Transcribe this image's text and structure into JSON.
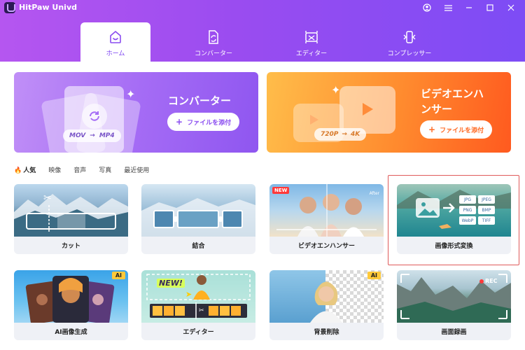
{
  "app": {
    "title": "HitPaw Univd"
  },
  "window_controls": [
    {
      "name": "account-icon",
      "glyph": "◯"
    },
    {
      "name": "menu-icon",
      "glyph": "≡"
    },
    {
      "name": "minimize-icon",
      "glyph": "—"
    },
    {
      "name": "maximize-icon",
      "glyph": "☐"
    },
    {
      "name": "close-icon",
      "glyph": "✕"
    }
  ],
  "tabs": [
    {
      "label": "ホーム",
      "icon": "home-icon",
      "active": true
    },
    {
      "label": "コンバーター",
      "icon": "converter-icon",
      "active": false
    },
    {
      "label": "エディター",
      "icon": "editor-icon",
      "active": false
    },
    {
      "label": "コンプレッサー",
      "icon": "compressor-icon",
      "active": false
    }
  ],
  "banners": {
    "converter": {
      "title": "コンバーター",
      "button": "ファイルを添付",
      "from": "MOV",
      "to": "MP4"
    },
    "enhancer": {
      "title_line1": "ビデオエンハ",
      "title_line2": "ンサー",
      "button": "ファイルを添付",
      "from": "720P",
      "to": "4K"
    }
  },
  "categories": [
    {
      "label": "人気",
      "active": true
    },
    {
      "label": "映像",
      "active": false
    },
    {
      "label": "音声",
      "active": false
    },
    {
      "label": "写真",
      "active": false
    },
    {
      "label": "最近使用",
      "active": false
    }
  ],
  "tools": {
    "cut": {
      "label": "カット"
    },
    "merge": {
      "label": "結合"
    },
    "video_enhancer": {
      "label": "ビデオエンハンサー",
      "badge": "NEW",
      "after": "After"
    },
    "image_converter": {
      "label": "画像形式変換",
      "formats": [
        "JPG",
        "JPEG",
        "PNG",
        "BMP",
        "WebP",
        "TIFF"
      ]
    },
    "ai_image": {
      "label": "AI画像生成",
      "badge": "AI"
    },
    "editor": {
      "label": "エディター",
      "sticker": "NEW!"
    },
    "bg_remove": {
      "label": "背景削除",
      "badge": "AI"
    },
    "screen_record": {
      "label": "画面録画",
      "rec": "REC"
    }
  },
  "colors": {
    "accent": "#7a3ff0",
    "header_start": "#b556f0",
    "header_end": "#7d4cf5",
    "enhancer_orange": "#ff6a24",
    "highlight_red": "#e05a5a"
  }
}
